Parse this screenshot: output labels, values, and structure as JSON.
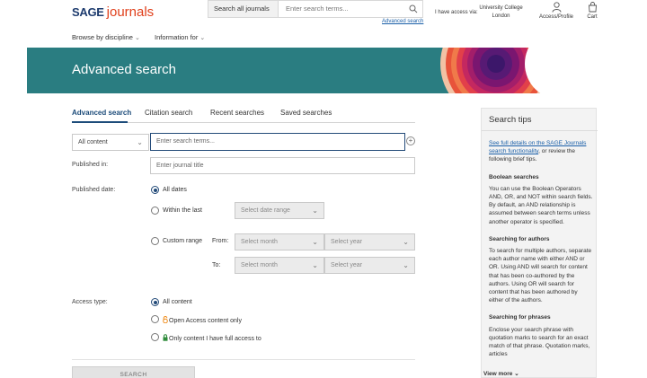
{
  "header": {
    "logo_brand": "SAGE",
    "logo_product": "journals",
    "search_scope": "Search all journals",
    "search_placeholder": "Enter search terms...",
    "advanced_link": "Advanced search",
    "access_label": "I have access via:",
    "institution": "University College London",
    "account_label": "Access/Profile",
    "cart_label": "Cart"
  },
  "nav": {
    "items": [
      {
        "label": "Browse by discipline"
      },
      {
        "label": "Information for"
      }
    ]
  },
  "banner": {
    "title": "Advanced search",
    "color": "#2a7d81"
  },
  "tabs": [
    {
      "label": "Advanced search",
      "active": true
    },
    {
      "label": "Citation search",
      "active": false
    },
    {
      "label": "Recent searches",
      "active": false
    },
    {
      "label": "Saved searches",
      "active": false
    }
  ],
  "form": {
    "field_select": "All content",
    "terms_placeholder": "Enter search terms...",
    "published_in_label": "Published in:",
    "journal_placeholder": "Enter journal title",
    "published_date_label": "Published date:",
    "date_options": {
      "all": "All dates",
      "within": "Within the last",
      "custom": "Custom range"
    },
    "date_range_placeholder": "Select date range",
    "from_label": "From:",
    "to_label": "To:",
    "month_placeholder": "Select month",
    "year_placeholder": "Select year",
    "access_type_label": "Access type:",
    "access_options": {
      "all": "All content",
      "open": "Open Access content only",
      "full": "Only content I have full access to"
    },
    "search_button": "SEARCH"
  },
  "sidebar": {
    "title": "Search tips",
    "intro_link": "See full details on the SAGE Journals search functionality",
    "intro_rest": ", or review the following brief tips.",
    "sections": [
      {
        "heading": "Boolean searches",
        "text": "You can use the Boolean Operators AND, OR, and NOT within search fields. By default, an AND relationship is assumed between search terms unless another operator is specified."
      },
      {
        "heading": "Searching for authors",
        "text": "To search for multiple authors, separate each author name with either AND or OR. Using AND will search for content that has been co-authored by the authors. Using OR will search for content that has been authored by either of the authors."
      },
      {
        "heading": "Searching for phrases",
        "text": "Enclose your search phrase with quotation marks to search for an exact match of that phrase. Quotation marks, articles"
      }
    ],
    "view_more": "View more"
  }
}
